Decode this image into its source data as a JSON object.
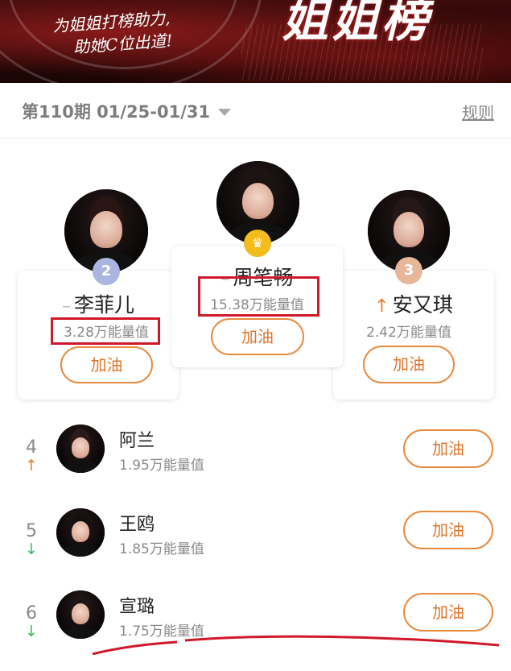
{
  "banner": {
    "slogan_line1": "为姐姐打榜助力,",
    "slogan_line2": "助她C位出道!",
    "title": "姐姐榜"
  },
  "period": {
    "label": "第110期 01/25-01/31"
  },
  "rules_link": "规则",
  "podium": [
    {
      "rank": "2",
      "name": "李菲儿",
      "trend": "–",
      "energy": "3.28万能量值",
      "cheer": "加油"
    },
    {
      "rank": "1",
      "name": "周笔畅",
      "trend": "–",
      "energy": "15.38万能量值",
      "cheer": "加油"
    },
    {
      "rank": "3",
      "name": "安又琪",
      "trend": "↑",
      "energy": "2.42万能量值",
      "cheer": "加油"
    }
  ],
  "list": [
    {
      "rank": "4",
      "trend": "↑",
      "name": "阿兰",
      "energy": "1.95万能量值",
      "cheer": "加油"
    },
    {
      "rank": "5",
      "trend": "↓",
      "name": "王鸥",
      "energy": "1.85万能量值",
      "cheer": "加油"
    },
    {
      "rank": "6",
      "trend": "↓",
      "name": "宣璐",
      "energy": "1.75万能量值",
      "cheer": "加油"
    }
  ],
  "colors": {
    "accent": "#e0752c",
    "trend_up": "#f07e22",
    "trend_down": "#31c05b",
    "highlight": "#d0182a"
  },
  "icons": {
    "rank1": "crown-icon",
    "period_dropdown": "chevron-down-icon"
  }
}
